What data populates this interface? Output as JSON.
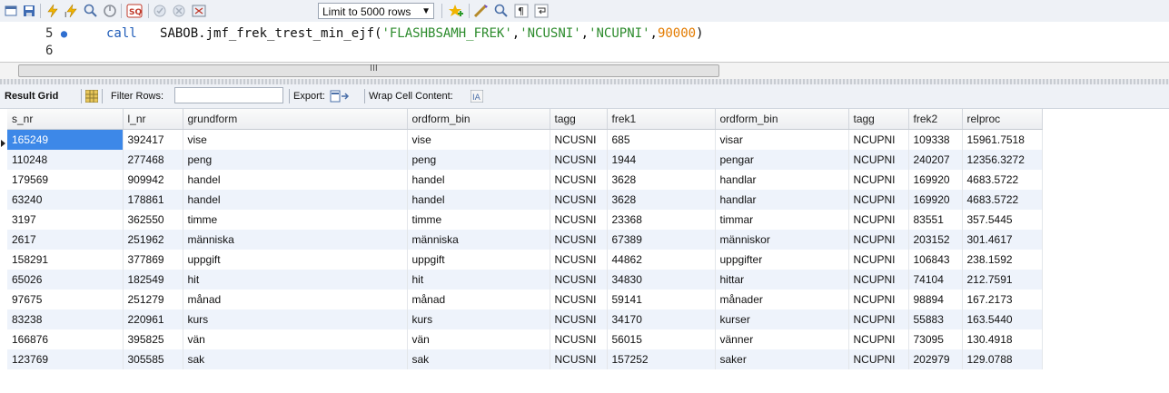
{
  "toolbar": {
    "limit_rows_label": "Limit to 5000 rows",
    "icons": [
      "new-tab-icon",
      "save-icon",
      "execute-icon",
      "execute-current-icon",
      "explain-icon",
      "stop-icon",
      "toggle-autocommit-icon",
      "commit-icon",
      "rollback-icon",
      "toggle-error-icon",
      "add-snippet-icon",
      "beautify-icon",
      "find-icon",
      "invisible-chars-icon",
      "wrap-lines-icon"
    ]
  },
  "editor": {
    "lines": [
      {
        "number": "5",
        "has_marker": true,
        "keyword": "call",
        "code_parts": [
          {
            "t": "SABOB.jmf_frek_trest_min_ejf(",
            "c": "plain"
          },
          {
            "t": "'FLASHBSAMH_FREK'",
            "c": "str"
          },
          {
            "t": ",",
            "c": "plain"
          },
          {
            "t": "'NCUSNI'",
            "c": "str"
          },
          {
            "t": ",",
            "c": "plain"
          },
          {
            "t": "'NCUPNI'",
            "c": "str"
          },
          {
            "t": ",",
            "c": "plain"
          },
          {
            "t": "90000",
            "c": "num"
          },
          {
            "t": ")",
            "c": "plain"
          }
        ]
      },
      {
        "number": "6",
        "has_marker": false
      }
    ]
  },
  "scrollbar": {
    "grip": "III"
  },
  "result_bar": {
    "result_grid_label": "Result Grid",
    "filter_rows_label": "Filter Rows:",
    "filter_value": "",
    "export_label": "Export:",
    "wrap_label": "Wrap Cell Content:"
  },
  "grid": {
    "columns": [
      "s_nr",
      "l_nr",
      "grundform",
      "ordform_bin",
      "tagg",
      "frek1",
      "ordform_bin",
      "tagg",
      "frek2",
      "relproc"
    ],
    "rows": [
      [
        "165249",
        "392417",
        "vise",
        "vise",
        "NCUSNI",
        "685",
        "visar",
        "NCUPNI",
        "109338",
        "15961.7518"
      ],
      [
        "110248",
        "277468",
        "peng",
        "peng",
        "NCUSNI",
        "1944",
        "pengar",
        "NCUPNI",
        "240207",
        "12356.3272"
      ],
      [
        "179569",
        "909942",
        "handel",
        "handel",
        "NCUSNI",
        "3628",
        "handlar",
        "NCUPNI",
        "169920",
        "4683.5722"
      ],
      [
        "63240",
        "178861",
        "handel",
        "handel",
        "NCUSNI",
        "3628",
        "handlar",
        "NCUPNI",
        "169920",
        "4683.5722"
      ],
      [
        "3197",
        "362550",
        "timme",
        "timme",
        "NCUSNI",
        "23368",
        "timmar",
        "NCUPNI",
        "83551",
        "357.5445"
      ],
      [
        "2617",
        "251962",
        "människa",
        "människa",
        "NCUSNI",
        "67389",
        "människor",
        "NCUPNI",
        "203152",
        "301.4617"
      ],
      [
        "158291",
        "377869",
        "uppgift",
        "uppgift",
        "NCUSNI",
        "44862",
        "uppgifter",
        "NCUPNI",
        "106843",
        "238.1592"
      ],
      [
        "65026",
        "182549",
        "hit",
        "hit",
        "NCUSNI",
        "34830",
        "hittar",
        "NCUPNI",
        "74104",
        "212.7591"
      ],
      [
        "97675",
        "251279",
        "månad",
        "månad",
        "NCUSNI",
        "59141",
        "månader",
        "NCUPNI",
        "98894",
        "167.2173"
      ],
      [
        "83238",
        "220961",
        "kurs",
        "kurs",
        "NCUSNI",
        "34170",
        "kurser",
        "NCUPNI",
        "55883",
        "163.5440"
      ],
      [
        "166876",
        "395825",
        "vän",
        "vän",
        "NCUSNI",
        "56015",
        "vänner",
        "NCUPNI",
        "73095",
        "130.4918"
      ],
      [
        "123769",
        "305585",
        "sak",
        "sak",
        "NCUSNI",
        "157252",
        "saker",
        "NCUPNI",
        "202979",
        "129.0788"
      ]
    ],
    "selected_row": 0,
    "selected_col": 0
  },
  "colors": {
    "selection": "#3d88e8",
    "keyword": "#1e5bb8",
    "string": "#2c8b2c",
    "number": "#e37b00",
    "alt_row": "#eef3fb"
  }
}
